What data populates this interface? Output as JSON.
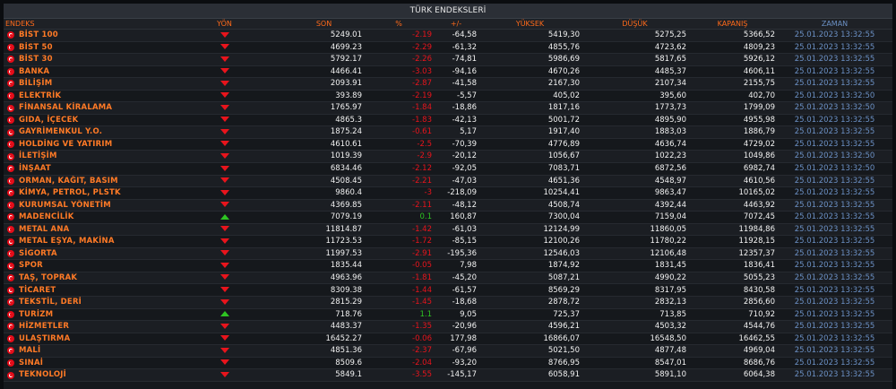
{
  "title": "TÜRK ENDEKSLERİ",
  "columns": {
    "name": "ENDEKS",
    "dir": "YÖN",
    "last": "SON",
    "pct": "%",
    "change": "+/-",
    "high": "YÜKSEK",
    "low": "DÜŞÜK",
    "close": "KAPANIŞ",
    "time": "ZAMAN"
  },
  "rows": [
    {
      "name": "BİST 100",
      "dir": "down",
      "last": "5249.01",
      "pct": "-2.19",
      "change": "-64,58",
      "high": "5419,30",
      "low": "5275,25",
      "close": "5366,52",
      "time": "25.01.2023 13:32:55"
    },
    {
      "name": "BİST 50",
      "dir": "down",
      "last": "4699.23",
      "pct": "-2.29",
      "change": "-61,32",
      "high": "4855,76",
      "low": "4723,62",
      "close": "4809,23",
      "time": "25.01.2023 13:32:55"
    },
    {
      "name": "BİST 30",
      "dir": "down",
      "last": "5792.17",
      "pct": "-2.26",
      "change": "-74,81",
      "high": "5986,69",
      "low": "5817,65",
      "close": "5926,12",
      "time": "25.01.2023 13:32:55"
    },
    {
      "name": "BANKA",
      "dir": "down",
      "last": "4466.41",
      "pct": "-3.03",
      "change": "-94,16",
      "high": "4670,26",
      "low": "4485,37",
      "close": "4606,11",
      "time": "25.01.2023 13:32:55"
    },
    {
      "name": "BİLİŞİM",
      "dir": "down",
      "last": "2093.91",
      "pct": "-2.87",
      "change": "-41,58",
      "high": "2167,30",
      "low": "2107,34",
      "close": "2155,75",
      "time": "25.01.2023 13:32:55"
    },
    {
      "name": "ELEKTRİK",
      "dir": "down",
      "last": "393.89",
      "pct": "-2.19",
      "change": "-5,57",
      "high": "405,02",
      "low": "395,60",
      "close": "402,70",
      "time": "25.01.2023 13:32:50"
    },
    {
      "name": "FİNANSAL KİRALAMA",
      "dir": "down",
      "last": "1765.97",
      "pct": "-1.84",
      "change": "-18,86",
      "high": "1817,16",
      "low": "1773,73",
      "close": "1799,09",
      "time": "25.01.2023 13:32:50"
    },
    {
      "name": "GIDA, İÇECEK",
      "dir": "down",
      "last": "4865.3",
      "pct": "-1.83",
      "change": "-42,13",
      "high": "5001,72",
      "low": "4895,90",
      "close": "4955,98",
      "time": "25.01.2023 13:32:55"
    },
    {
      "name": "GAYRİMENKUL Y.O.",
      "dir": "down",
      "last": "1875.24",
      "pct": "-0.61",
      "change": "5,17",
      "high": "1917,40",
      "low": "1883,03",
      "close": "1886,79",
      "time": "25.01.2023 13:32:55"
    },
    {
      "name": "HOLDİNG VE YATIRIM",
      "dir": "down",
      "last": "4610.61",
      "pct": "-2.5",
      "change": "-70,39",
      "high": "4776,89",
      "low": "4636,74",
      "close": "4729,02",
      "time": "25.01.2023 13:32:55"
    },
    {
      "name": "İLETİŞİM",
      "dir": "down",
      "last": "1019.39",
      "pct": "-2.9",
      "change": "-20,12",
      "high": "1056,67",
      "low": "1022,23",
      "close": "1049,86",
      "time": "25.01.2023 13:32:50"
    },
    {
      "name": "İNŞAAT",
      "dir": "down",
      "last": "6834.46",
      "pct": "-2.12",
      "change": "-92,05",
      "high": "7083,71",
      "low": "6872,56",
      "close": "6982,74",
      "time": "25.01.2023 13:32:50"
    },
    {
      "name": "ORMAN, KAĞIT, BASIM",
      "dir": "down",
      "last": "4508.45",
      "pct": "-2.21",
      "change": "-47,03",
      "high": "4651,36",
      "low": "4548,97",
      "close": "4610,56",
      "time": "25.01.2023 13:32:55"
    },
    {
      "name": "KİMYA, PETROL, PLSTK",
      "dir": "down",
      "last": "9860.4",
      "pct": "-3",
      "change": "-218,09",
      "high": "10254,41",
      "low": "9863,47",
      "close": "10165,02",
      "time": "25.01.2023 13:32:55"
    },
    {
      "name": "KURUMSAL YÖNETİM",
      "dir": "down",
      "last": "4369.85",
      "pct": "-2.11",
      "change": "-48,12",
      "high": "4508,74",
      "low": "4392,44",
      "close": "4463,92",
      "time": "25.01.2023 13:32:55"
    },
    {
      "name": "MADENCİLİK",
      "dir": "up",
      "last": "7079.19",
      "pct": "0.1",
      "change": "160,87",
      "high": "7300,04",
      "low": "7159,04",
      "close": "7072,45",
      "time": "25.01.2023 13:32:55"
    },
    {
      "name": "METAL ANA",
      "dir": "down",
      "last": "11814.87",
      "pct": "-1.42",
      "change": "-61,03",
      "high": "12124,99",
      "low": "11860,05",
      "close": "11984,86",
      "time": "25.01.2023 13:32:55"
    },
    {
      "name": "METAL EŞYA, MAKİNA",
      "dir": "down",
      "last": "11723.53",
      "pct": "-1.72",
      "change": "-85,15",
      "high": "12100,26",
      "low": "11780,22",
      "close": "11928,15",
      "time": "25.01.2023 13:32:55"
    },
    {
      "name": "SİGORTA",
      "dir": "down",
      "last": "11997.53",
      "pct": "-2.91",
      "change": "-195,36",
      "high": "12546,03",
      "low": "12106,48",
      "close": "12357,37",
      "time": "25.01.2023 13:32:55"
    },
    {
      "name": "SPOR",
      "dir": "down",
      "last": "1835.44",
      "pct": "-0.05",
      "change": "7,98",
      "high": "1874,92",
      "low": "1831,45",
      "close": "1836,41",
      "time": "25.01.2023 13:32:55"
    },
    {
      "name": "TAŞ, TOPRAK",
      "dir": "down",
      "last": "4963.96",
      "pct": "-1.81",
      "change": "-45,20",
      "high": "5087,21",
      "low": "4990,22",
      "close": "5055,23",
      "time": "25.01.2023 13:32:55"
    },
    {
      "name": "TİCARET",
      "dir": "down",
      "last": "8309.38",
      "pct": "-1.44",
      "change": "-61,57",
      "high": "8569,29",
      "low": "8317,95",
      "close": "8430,58",
      "time": "25.01.2023 13:32:55"
    },
    {
      "name": "TEKSTİL, DERİ",
      "dir": "down",
      "last": "2815.29",
      "pct": "-1.45",
      "change": "-18,68",
      "high": "2878,72",
      "low": "2832,13",
      "close": "2856,60",
      "time": "25.01.2023 13:32:55"
    },
    {
      "name": "TURİZM",
      "dir": "up",
      "last": "718.76",
      "pct": "1.1",
      "change": "9,05",
      "high": "725,37",
      "low": "713,85",
      "close": "710,92",
      "time": "25.01.2023 13:32:55"
    },
    {
      "name": "HİZMETLER",
      "dir": "down",
      "last": "4483.37",
      "pct": "-1.35",
      "change": "-20,96",
      "high": "4596,21",
      "low": "4503,32",
      "close": "4544,76",
      "time": "25.01.2023 13:32:55"
    },
    {
      "name": "ULAŞTIRMA",
      "dir": "down",
      "last": "16452.27",
      "pct": "-0.06",
      "change": "177,98",
      "high": "16866,07",
      "low": "16548,50",
      "close": "16462,55",
      "time": "25.01.2023 13:32:55"
    },
    {
      "name": "MALİ",
      "dir": "down",
      "last": "4851.36",
      "pct": "-2.37",
      "change": "-67,96",
      "high": "5021,50",
      "low": "4877,48",
      "close": "4969,04",
      "time": "25.01.2023 13:32:55"
    },
    {
      "name": "SINAİ",
      "dir": "down",
      "last": "8509.6",
      "pct": "-2.04",
      "change": "-93,20",
      "high": "8766,95",
      "low": "8547,01",
      "close": "8686,76",
      "time": "25.01.2023 13:32:55"
    },
    {
      "name": "TEKNOLOJİ",
      "dir": "down",
      "last": "5849.1",
      "pct": "-3.55",
      "change": "-145,17",
      "high": "6058,91",
      "low": "5891,10",
      "close": "6064,38",
      "time": "25.01.2023 13:32:55"
    }
  ]
}
